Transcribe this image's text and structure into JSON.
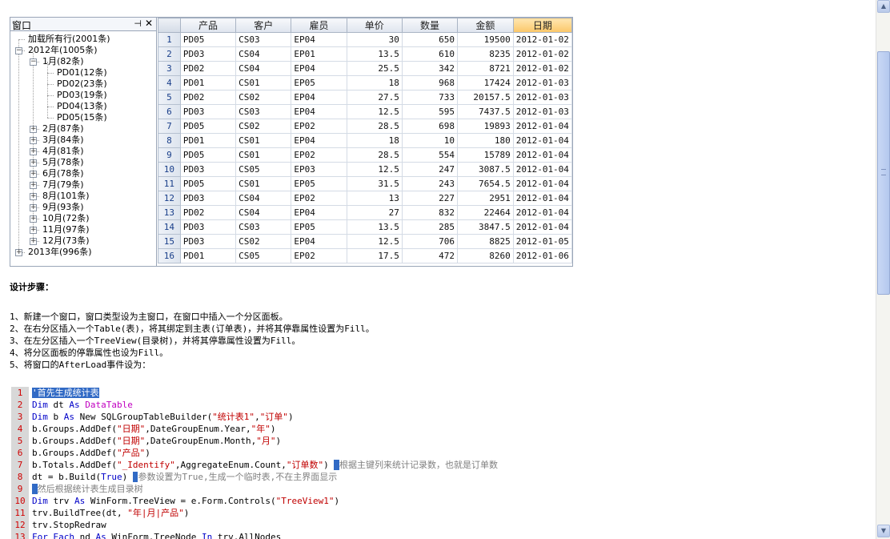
{
  "tree_panel": {
    "title": "窗口",
    "pin_icon": "pin-icon",
    "close_icon": "close-icon",
    "nodes": [
      {
        "label": "加载所有行(2001条)",
        "level": 0,
        "box": ""
      },
      {
        "label": "2012年(1005条)",
        "level": 0,
        "box": "−"
      },
      {
        "label": "1月(82条)",
        "level": 1,
        "box": "−"
      },
      {
        "label": "PD01(12条)",
        "level": 2,
        "box": ""
      },
      {
        "label": "PD02(23条)",
        "level": 2,
        "box": ""
      },
      {
        "label": "PD03(19条)",
        "level": 2,
        "box": ""
      },
      {
        "label": "PD04(13条)",
        "level": 2,
        "box": ""
      },
      {
        "label": "PD05(15条)",
        "level": 2,
        "box": ""
      },
      {
        "label": "2月(87条)",
        "level": 1,
        "box": "+"
      },
      {
        "label": "3月(84条)",
        "level": 1,
        "box": "+"
      },
      {
        "label": "4月(81条)",
        "level": 1,
        "box": "+"
      },
      {
        "label": "5月(78条)",
        "level": 1,
        "box": "+"
      },
      {
        "label": "6月(78条)",
        "level": 1,
        "box": "+"
      },
      {
        "label": "7月(79条)",
        "level": 1,
        "box": "+"
      },
      {
        "label": "8月(101条)",
        "level": 1,
        "box": "+"
      },
      {
        "label": "9月(93条)",
        "level": 1,
        "box": "+"
      },
      {
        "label": "10月(72条)",
        "level": 1,
        "box": "+"
      },
      {
        "label": "11月(97条)",
        "level": 1,
        "box": "+"
      },
      {
        "label": "12月(73条)",
        "level": 1,
        "box": "+"
      },
      {
        "label": "2013年(996条)",
        "level": 0,
        "box": "+"
      }
    ]
  },
  "grid": {
    "columns": [
      "产品",
      "客户",
      "雇员",
      "单价",
      "数量",
      "金额",
      "日期"
    ],
    "sorted_column": "日期",
    "rows": [
      [
        "1",
        "PD05",
        "CS03",
        "EP04",
        "30",
        "650",
        "19500",
        "2012-01-02"
      ],
      [
        "2",
        "PD03",
        "CS04",
        "EP01",
        "13.5",
        "610",
        "8235",
        "2012-01-02"
      ],
      [
        "3",
        "PD02",
        "CS04",
        "EP04",
        "25.5",
        "342",
        "8721",
        "2012-01-02"
      ],
      [
        "4",
        "PD01",
        "CS01",
        "EP05",
        "18",
        "968",
        "17424",
        "2012-01-03"
      ],
      [
        "5",
        "PD02",
        "CS02",
        "EP04",
        "27.5",
        "733",
        "20157.5",
        "2012-01-03"
      ],
      [
        "6",
        "PD03",
        "CS03",
        "EP04",
        "12.5",
        "595",
        "7437.5",
        "2012-01-03"
      ],
      [
        "7",
        "PD05",
        "CS02",
        "EP02",
        "28.5",
        "698",
        "19893",
        "2012-01-04"
      ],
      [
        "8",
        "PD01",
        "CS01",
        "EP04",
        "18",
        "10",
        "180",
        "2012-01-04"
      ],
      [
        "9",
        "PD05",
        "CS01",
        "EP02",
        "28.5",
        "554",
        "15789",
        "2012-01-04"
      ],
      [
        "10",
        "PD03",
        "CS05",
        "EP03",
        "12.5",
        "247",
        "3087.5",
        "2012-01-04"
      ],
      [
        "11",
        "PD05",
        "CS01",
        "EP05",
        "31.5",
        "243",
        "7654.5",
        "2012-01-04"
      ],
      [
        "12",
        "PD03",
        "CS04",
        "EP02",
        "13",
        "227",
        "2951",
        "2012-01-04"
      ],
      [
        "13",
        "PD02",
        "CS04",
        "EP04",
        "27",
        "832",
        "22464",
        "2012-01-04"
      ],
      [
        "14",
        "PD03",
        "CS03",
        "EP05",
        "13.5",
        "285",
        "3847.5",
        "2012-01-04"
      ],
      [
        "15",
        "PD03",
        "CS02",
        "EP04",
        "12.5",
        "706",
        "8825",
        "2012-01-05"
      ],
      [
        "16",
        "PD01",
        "CS05",
        "EP02",
        "17.5",
        "472",
        "8260",
        "2012-01-06"
      ]
    ]
  },
  "doc": {
    "heading": "设计步骤：",
    "steps": [
      "1、新建一个窗口，窗口类型设为主窗口，在窗口中插入一个分区面板。",
      "2、在右分区插入一个Table(表)，将其绑定到主表(订单表)，并将其停靠属性设置为Fill。",
      "3、在左分区插入一个TreeView(目录树)，并将其停靠属性设置为Fill。",
      "4、将分区面板的停靠属性也设为Fill。",
      "5、将窗口的AfterLoad事件设为："
    ]
  },
  "code_lines": [
    [
      [
        "hl",
        "'首先生成统计表"
      ]
    ],
    [
      [
        "k",
        "Dim"
      ],
      [
        "",
        " dt "
      ],
      [
        "k",
        "As"
      ],
      [
        "",
        " "
      ],
      [
        "t",
        "DataTable"
      ]
    ],
    [
      [
        "k",
        "Dim"
      ],
      [
        "",
        " b "
      ],
      [
        "k",
        "As"
      ],
      [
        "",
        " New SQLGroupTableBuilder("
      ],
      [
        "s",
        "\"统计表1\""
      ],
      [
        "",
        ","
      ],
      [
        "s",
        "\"订单\""
      ],
      [
        "",
        ")"
      ]
    ],
    [
      [
        "",
        "b.Groups.AddDef("
      ],
      [
        "s",
        "\"日期\""
      ],
      [
        "",
        ",DateGroupEnum.Year,"
      ],
      [
        "s",
        "\"年\""
      ],
      [
        "",
        ")"
      ]
    ],
    [
      [
        "",
        "b.Groups.AddDef("
      ],
      [
        "s",
        "\"日期\""
      ],
      [
        "",
        ",DateGroupEnum.Month,"
      ],
      [
        "s",
        "\"月\""
      ],
      [
        "",
        ")"
      ]
    ],
    [
      [
        "",
        "b.Groups.AddDef("
      ],
      [
        "s",
        "\"产品\""
      ],
      [
        "",
        ")"
      ]
    ],
    [
      [
        "",
        "b.Totals.AddDef("
      ],
      [
        "s",
        "\"_Identify\""
      ],
      [
        "",
        ",AggregateEnum.Count,"
      ],
      [
        "s",
        "\"订单数\""
      ],
      [
        "",
        ") "
      ],
      [
        "caret",
        "'"
      ],
      [
        "c",
        "根据主键列来统计记录数，也就是订单数"
      ]
    ],
    [
      [
        "",
        "dt = b.Build("
      ],
      [
        "k",
        "True"
      ],
      [
        "",
        ") "
      ],
      [
        "caret",
        "'"
      ],
      [
        "c",
        "参数设置为True,生成一个临时表,不在主界面显示"
      ]
    ],
    [
      [
        "caret",
        "'"
      ],
      [
        "c",
        "然后根据统计表生成目录树"
      ]
    ],
    [
      [
        "k",
        "Dim"
      ],
      [
        "",
        " trv "
      ],
      [
        "k",
        "As"
      ],
      [
        "",
        " WinForm.TreeView = e.Form.Controls("
      ],
      [
        "s",
        "\"TreeView1\""
      ],
      [
        "",
        ")"
      ]
    ],
    [
      [
        "",
        "trv.BuildTree(dt, "
      ],
      [
        "s",
        "\"年|月|产品\""
      ],
      [
        "",
        ")"
      ]
    ],
    [
      [
        "",
        "trv.StopRedraw"
      ]
    ],
    [
      [
        "k",
        "For Each"
      ],
      [
        "",
        " nd "
      ],
      [
        "k",
        "As"
      ],
      [
        "",
        " WinForm.TreeNode "
      ],
      [
        "k",
        "In"
      ],
      [
        "",
        " trv.AllNodes"
      ]
    ]
  ],
  "scrollbar": {
    "up_icon": "arrow-up-icon",
    "down_icon": "arrow-down-icon"
  }
}
